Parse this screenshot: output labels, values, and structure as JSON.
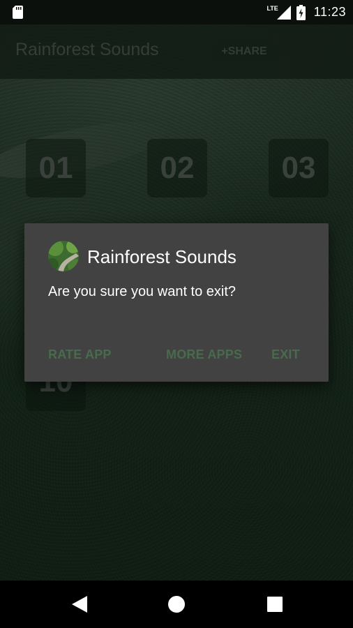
{
  "status_bar": {
    "network": "LTE",
    "time": "11:23",
    "icons": [
      "sd-card-icon",
      "signal-icon",
      "battery-icon"
    ]
  },
  "toolbar": {
    "title": "Rainforest Sounds",
    "share_label": "+SHARE"
  },
  "tiles": [
    "01",
    "02",
    "03",
    "10"
  ],
  "dialog": {
    "title": "Rainforest Sounds",
    "message": "Are you sure you want to exit?",
    "buttons": {
      "rate": "RATE APP",
      "more": "MORE APPS",
      "exit": "EXIT"
    }
  },
  "nav_bar": {
    "icons": [
      "back-icon",
      "home-icon",
      "recents-icon"
    ]
  },
  "colors": {
    "dialog_bg": "#424242",
    "dialog_button": "#486b4d",
    "toolbar_title": "#5f6f63"
  }
}
